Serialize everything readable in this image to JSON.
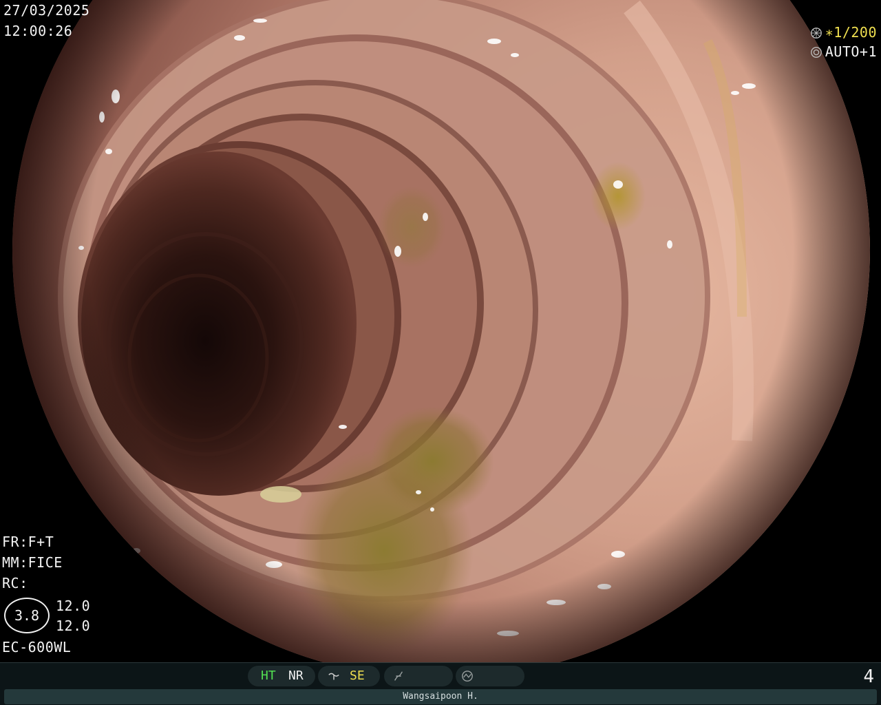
{
  "overlay": {
    "date": "27/03/2025",
    "time": "12:00:26",
    "shutter": "∗1/200",
    "auto": "AUTO+1",
    "fr": "FR:F+T",
    "mm": "MM:FICE",
    "rc": "RC:",
    "zoom": "3.8",
    "value_1": "12.0",
    "value_2": "12.0",
    "scope_model": "EC-600WL"
  },
  "status_bar": {
    "ht": "HT",
    "nr": "NR",
    "se": "SE",
    "frame_number": "4",
    "operator": "Wangsaipoon H."
  },
  "colors": {
    "ht_green": "#52e052",
    "se_yellow": "#f0e050",
    "shutter_yellow": "#f0e050",
    "status_bg": "#0c1517",
    "name_bar_bg": "#24393b"
  },
  "icons": [
    "shutter-icon",
    "iris-icon",
    "enhance-icon",
    "structure-icon",
    "color-icon"
  ]
}
